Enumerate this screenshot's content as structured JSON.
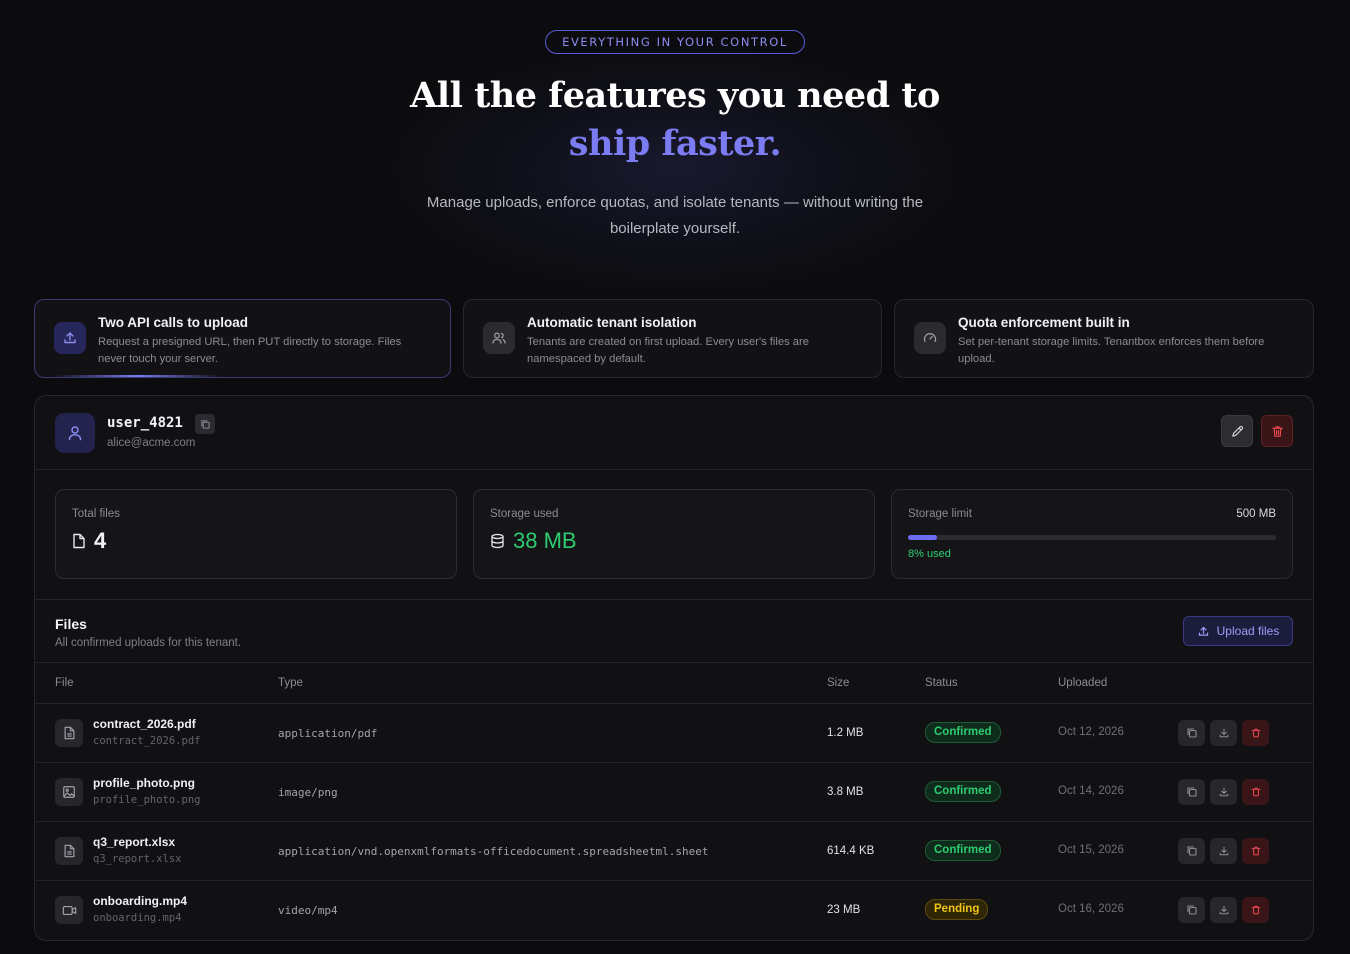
{
  "hero": {
    "pill": "EVERYTHING IN YOUR CONTROL",
    "title_line1": "All the features you need to",
    "title_line2": "ship faster.",
    "subtitle": "Manage uploads, enforce quotas, and isolate tenants — without writing the boilerplate yourself."
  },
  "features": [
    {
      "title": "Two API calls to upload",
      "desc": "Request a presigned URL, then PUT directly to storage. Files never touch your server.",
      "icon": "upload-icon",
      "active": true
    },
    {
      "title": "Automatic tenant isolation",
      "desc": "Tenants are created on first upload. Every user's files are namespaced by default.",
      "icon": "users-icon",
      "active": false
    },
    {
      "title": "Quota enforcement built in",
      "desc": "Set per-tenant storage limits. Tenantbox enforces them before upload.",
      "icon": "gauge-icon",
      "active": false
    }
  ],
  "user": {
    "username": "user_4821",
    "email": "alice@acme.com"
  },
  "stats": {
    "total_files_label": "Total files",
    "total_files_value": "4",
    "storage_used_label": "Storage used",
    "storage_used_value": "38 MB",
    "storage_limit_label": "Storage limit",
    "storage_limit_value": "500 MB",
    "used_fraction": 0.08,
    "used_note": "8% used"
  },
  "files": {
    "title": "Files",
    "subtitle": "All confirmed uploads for this tenant.",
    "upload_label": "Upload files",
    "columns": {
      "file": "File",
      "type": "Type",
      "size": "Size",
      "status": "Status",
      "uploaded": "Uploaded"
    },
    "rows": [
      {
        "name": "contract_2026.pdf",
        "key": "contract_2026.pdf",
        "type": "application/pdf",
        "size": "1.2 MB",
        "status": "Confirmed",
        "date": "Oct 12, 2026",
        "icon": "document-icon"
      },
      {
        "name": "profile_photo.png",
        "key": "profile_photo.png",
        "type": "image/png",
        "size": "3.8 MB",
        "status": "Confirmed",
        "date": "Oct 14, 2026",
        "icon": "image-icon"
      },
      {
        "name": "q3_report.xlsx",
        "key": "q3_report.xlsx",
        "type": "application/vnd.openxmlformats-officedocument.spreadsheetml.sheet",
        "size": "614.4 KB",
        "status": "Confirmed",
        "date": "Oct 15, 2026",
        "icon": "document-icon"
      },
      {
        "name": "onboarding.mp4",
        "key": "onboarding.mp4",
        "type": "video/mp4",
        "size": "23 MB",
        "status": "Pending",
        "date": "Oct 16, 2026",
        "icon": "video-icon"
      }
    ]
  },
  "colors": {
    "accent": "#7c7cf2",
    "success": "#2ecc71",
    "warning": "#f0c419",
    "danger": "#e5484d",
    "background": "#0c0c0f"
  }
}
